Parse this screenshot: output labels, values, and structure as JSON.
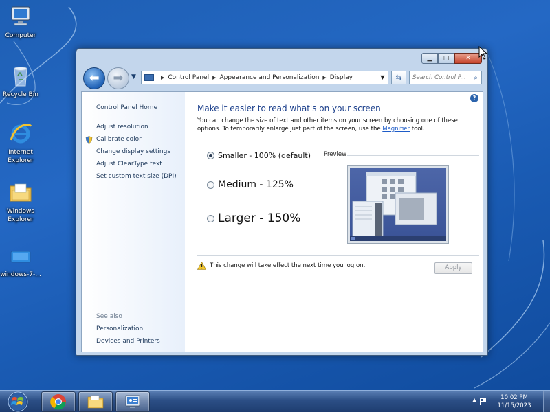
{
  "desktop": {
    "icons": [
      {
        "label": "Computer",
        "icon": "computer-icon"
      },
      {
        "label": "Recycle Bin",
        "icon": "recycle-bin-icon"
      },
      {
        "label": "Internet Explorer",
        "icon": "internet-explorer-icon"
      },
      {
        "label": "Windows Explorer",
        "icon": "windows-explorer-icon"
      },
      {
        "label": "windows-7-...",
        "icon": "file-icon"
      }
    ]
  },
  "window": {
    "controls": {
      "minimize": "▁",
      "maximize": "□",
      "close": "✕"
    },
    "breadcrumb": [
      "Control Panel",
      "Appearance and Personalization",
      "Display"
    ],
    "search_placeholder": "Search Control P...",
    "left_pane": {
      "home": "Control Panel Home",
      "tasks": [
        "Adjust resolution",
        "Calibrate color",
        "Change display settings",
        "Adjust ClearType text",
        "Set custom text size (DPI)"
      ],
      "see_also_label": "See also",
      "see_also": [
        "Personalization",
        "Devices and Printers"
      ]
    },
    "main": {
      "title": "Make it easier to read what's on your screen",
      "description_1": "You can change the size of text and other items on your screen by choosing one of these options. To temporarily enlarge just part of the screen, use the ",
      "magnifier_link": "Magnifier",
      "description_2": " tool.",
      "options": [
        {
          "label": "Smaller - 100% (default)",
          "selected": true
        },
        {
          "label": "Medium - 125%",
          "selected": false
        },
        {
          "label": "Larger - 150%",
          "selected": false
        }
      ],
      "preview_label": "Preview",
      "warning": "This change will take effect the next time you log on.",
      "apply_label": "Apply"
    }
  },
  "taskbar": {
    "clock_time": "10:02 PM",
    "clock_date": "11/15/2023",
    "tray_arrow": "▲"
  },
  "colors": {
    "title_blue": "#1b3f8b",
    "link_blue": "#1e395b",
    "desktop": "#1e5fb4"
  }
}
